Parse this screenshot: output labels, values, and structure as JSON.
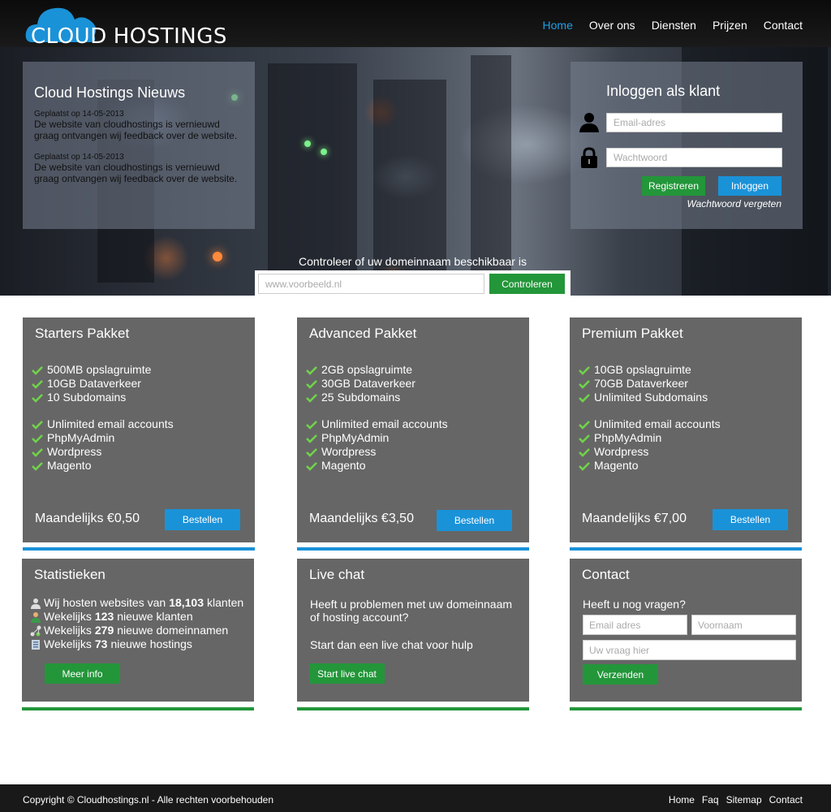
{
  "header": {
    "logo_part1": "CLOUD",
    "logo_part2": "HOSTINGS",
    "nav": [
      "Home",
      "Over ons",
      "Diensten",
      "Prijzen",
      "Contact"
    ],
    "active_nav": "Home"
  },
  "news": {
    "title": "Cloud Hostings Nieuws",
    "items": [
      {
        "date": "Geplaatst op 14-05-2013",
        "text": "De website van cloudhostings is vernieuwd graag ontvangen wij feedback over de website."
      },
      {
        "date": "Geplaatst op 14-05-2013",
        "text": "De website van cloudhostings is vernieuwd graag ontvangen wij feedback over de website."
      }
    ]
  },
  "login": {
    "title": "Inloggen als klant",
    "email_placeholder": "Email-adres",
    "password_placeholder": "Wachtwoord",
    "register_label": "Registreren",
    "login_label": "Inloggen",
    "forgot_label": "Wachtwoord vergeten"
  },
  "domain": {
    "label": "Controleer of uw domeinnaam beschikbaar is",
    "placeholder": "www.voorbeeld.nl",
    "button_label": "Controleren"
  },
  "packages": [
    {
      "title": "Starters Pakket",
      "features_a": [
        "500MB opslagruimte",
        "10GB Dataverkeer",
        "10 Subdomains"
      ],
      "features_b": [
        "Unlimited email accounts",
        "PhpMyAdmin",
        "Wordpress",
        "Magento"
      ],
      "price": "Maandelijks €0,50",
      "button": "Bestellen"
    },
    {
      "title": "Advanced Pakket",
      "features_a": [
        "2GB opslagruimte",
        "30GB Dataverkeer",
        "25 Subdomains"
      ],
      "features_b": [
        "Unlimited email accounts",
        "PhpMyAdmin",
        "Wordpress",
        "Magento"
      ],
      "price": "Maandelijks €3,50",
      "button": "Bestellen"
    },
    {
      "title": "Premium Pakket",
      "features_a": [
        "10GB opslagruimte",
        "70GB Dataverkeer",
        "Unlimited Subdomains"
      ],
      "features_b": [
        "Unlimited email accounts",
        "PhpMyAdmin",
        "Wordpress",
        "Magento"
      ],
      "price": "Maandelijks €7,00",
      "button": "Bestellen"
    }
  ],
  "stats": {
    "title": "Statistieken",
    "lines": [
      {
        "pre": "Wij hosten websites van",
        "num": "18,103",
        "post": "klanten"
      },
      {
        "pre": "Wekelijks",
        "num": "123",
        "post": "nieuwe klanten"
      },
      {
        "pre": "Wekelijks",
        "num": "279",
        "post": "nieuwe domeinnamen"
      },
      {
        "pre": "Wekelijks",
        "num": "73",
        "post": "nieuwe hostings"
      }
    ],
    "button": "Meer info"
  },
  "livechat": {
    "title": "Live chat",
    "text1": "Heeft u problemen met uw domeinnaam of hosting account?",
    "text2": "Start dan een live chat voor hulp",
    "button": "Start live chat"
  },
  "contact": {
    "title": "Contact",
    "question": "Heeft u nog vragen?",
    "email_placeholder": "Email adres",
    "name_placeholder": "Voornaam",
    "question_placeholder": "Uw vraag hier",
    "button": "Verzenden"
  },
  "footer": {
    "copyright": "Copyright © Cloudhostings.nl  -  Alle rechten voorbehouden",
    "links": [
      "Home",
      "Faq",
      "Sitemap",
      "Contact"
    ]
  },
  "colors": {
    "accent_blue": "#1a92d8",
    "accent_green": "#23963a",
    "card_gray": "#666666",
    "check_green": "#6fd34a"
  }
}
